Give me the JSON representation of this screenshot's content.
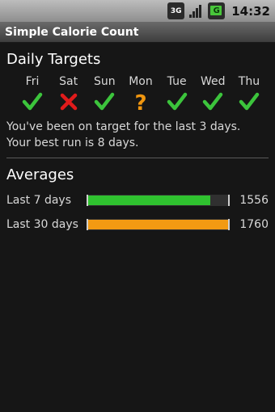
{
  "status_bar": {
    "network_label": "3G",
    "time": "14:32",
    "icons": [
      "network-3g-icon",
      "signal-icon",
      "battery-icon"
    ],
    "battery_letter": "G"
  },
  "app": {
    "title": "Simple Calorie Count"
  },
  "daily_targets": {
    "heading": "Daily Targets",
    "days": [
      {
        "label": "Fri",
        "status": "check"
      },
      {
        "label": "Sat",
        "status": "cross"
      },
      {
        "label": "Sun",
        "status": "check"
      },
      {
        "label": "Mon",
        "status": "unknown"
      },
      {
        "label": "Tue",
        "status": "check"
      },
      {
        "label": "Wed",
        "status": "check"
      },
      {
        "label": "Thu",
        "status": "check"
      }
    ],
    "summary_line1": "You've been on target for the last 3 days.",
    "summary_line2": "Your best run is 8 days."
  },
  "averages": {
    "heading": "Averages",
    "rows": [
      {
        "label": "Last 7 days",
        "value": "1556",
        "fill_fraction": 0.87,
        "color": "#2fc22f"
      },
      {
        "label": "Last 30 days",
        "value": "1760",
        "fill_fraction": 1.0,
        "color": "#f29a12"
      }
    ]
  },
  "colors": {
    "check": "#3cc43c",
    "cross": "#e01b1b",
    "unknown": "#f0960f"
  }
}
